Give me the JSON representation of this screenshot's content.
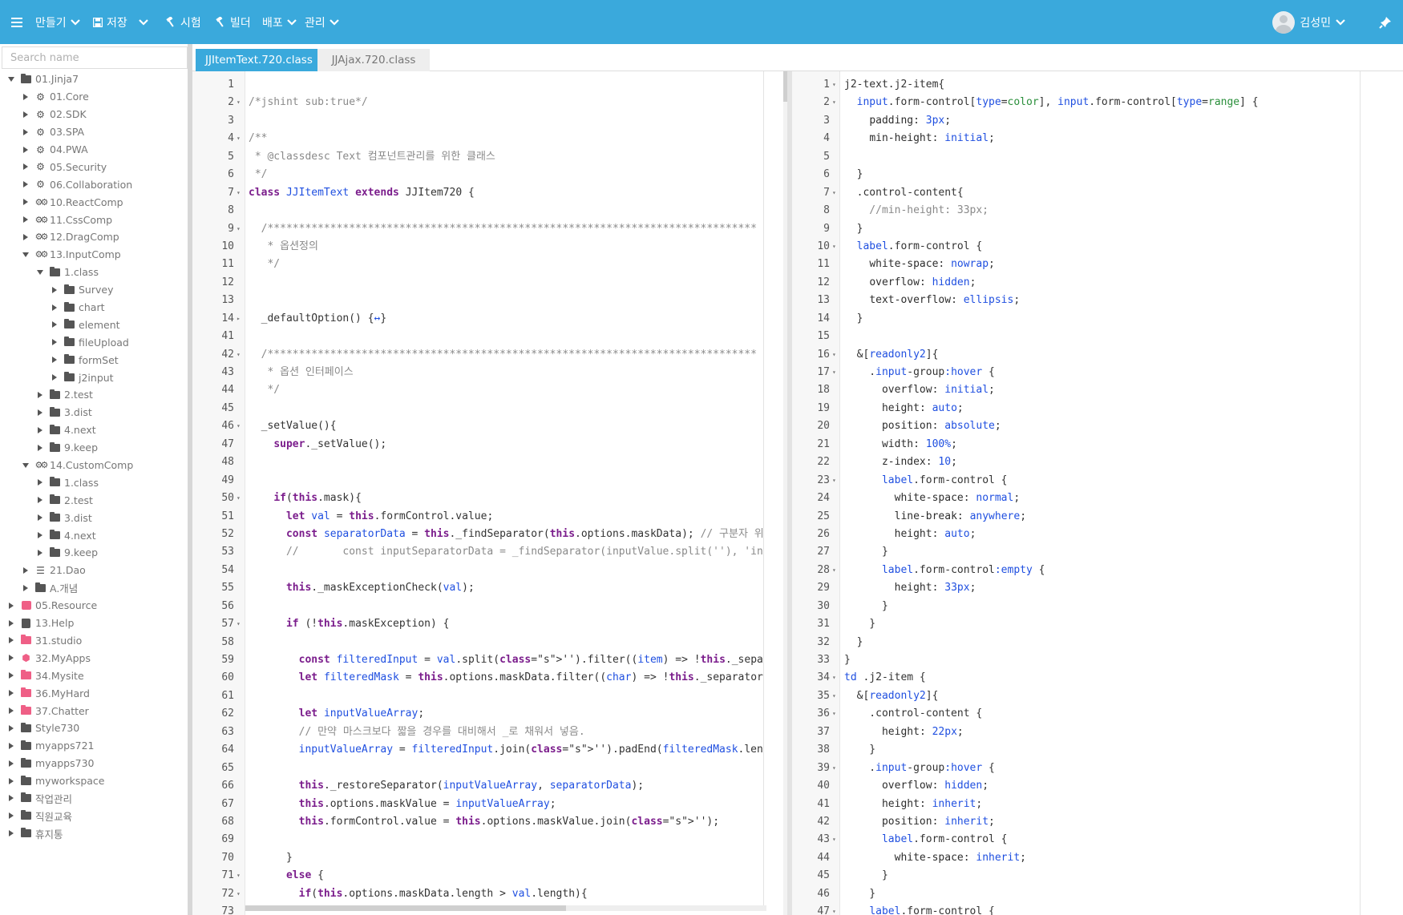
{
  "toolbar": {
    "menu_icon": "hamburger-icon",
    "make_label": "만들기",
    "save_label": "저장",
    "test_label": "시험",
    "build_label": "빌더",
    "deploy_label": "배포",
    "admin_label": "관리",
    "user_name": "김성민"
  },
  "search": {
    "placeholder": "Search name",
    "value": ""
  },
  "tree": [
    {
      "label": "01.Jinja7",
      "icon": "folder",
      "depth": 0,
      "expanded": true
    },
    {
      "label": "01.Core",
      "icon": "gear",
      "depth": 1
    },
    {
      "label": "02.SDK",
      "icon": "gear",
      "depth": 1
    },
    {
      "label": "03.SPA",
      "icon": "gear",
      "depth": 1
    },
    {
      "label": "04.PWA",
      "icon": "gear",
      "depth": 1
    },
    {
      "label": "05.Security",
      "icon": "gear",
      "depth": 1
    },
    {
      "label": "06.Collaboration",
      "icon": "gear",
      "depth": 1
    },
    {
      "label": "10.ReactComp",
      "icon": "gears",
      "depth": 1
    },
    {
      "label": "11.CssComp",
      "icon": "gears",
      "depth": 1
    },
    {
      "label": "12.DragComp",
      "icon": "gears",
      "depth": 1
    },
    {
      "label": "13.InputComp",
      "icon": "gears",
      "depth": 1,
      "expanded": true
    },
    {
      "label": "1.class",
      "icon": "folder",
      "depth": 2,
      "expanded": true
    },
    {
      "label": "Survey",
      "icon": "folder",
      "depth": 3
    },
    {
      "label": "chart",
      "icon": "folder",
      "depth": 3
    },
    {
      "label": "element",
      "icon": "folder",
      "depth": 3
    },
    {
      "label": "fileUpload",
      "icon": "folder",
      "depth": 3
    },
    {
      "label": "formSet",
      "icon": "folder",
      "depth": 3
    },
    {
      "label": "j2input",
      "icon": "folder",
      "depth": 3
    },
    {
      "label": "2.test",
      "icon": "folder",
      "depth": 2
    },
    {
      "label": "3.dist",
      "icon": "folder",
      "depth": 2
    },
    {
      "label": "4.next",
      "icon": "folder",
      "depth": 2
    },
    {
      "label": "9.keep",
      "icon": "folder",
      "depth": 2
    },
    {
      "label": "14.CustomComp",
      "icon": "gears",
      "depth": 1,
      "expanded": true
    },
    {
      "label": "1.class",
      "icon": "folder",
      "depth": 2
    },
    {
      "label": "2.test",
      "icon": "folder",
      "depth": 2
    },
    {
      "label": "3.dist",
      "icon": "folder",
      "depth": 2
    },
    {
      "label": "4.next",
      "icon": "folder",
      "depth": 2
    },
    {
      "label": "9.keep",
      "icon": "folder",
      "depth": 2
    },
    {
      "label": "21.Dao",
      "icon": "db",
      "depth": 1
    },
    {
      "label": "A.개념",
      "icon": "folder",
      "depth": 1
    },
    {
      "label": "05.Resource",
      "icon": "res",
      "depth": 0
    },
    {
      "label": "13.Help",
      "icon": "book",
      "depth": 0
    },
    {
      "label": "31.studio",
      "icon": "folder-pink",
      "depth": 0
    },
    {
      "label": "32.MyApps",
      "icon": "cube",
      "depth": 0
    },
    {
      "label": "34.Mysite",
      "icon": "folder-pink",
      "depth": 0
    },
    {
      "label": "36.MyHard",
      "icon": "folder-pink",
      "depth": 0
    },
    {
      "label": "37.Chatter",
      "icon": "folder-pink",
      "depth": 0
    },
    {
      "label": "Style730",
      "icon": "folder",
      "depth": 0
    },
    {
      "label": "myapps721",
      "icon": "folder",
      "depth": 0
    },
    {
      "label": "myapps730",
      "icon": "folder",
      "depth": 0
    },
    {
      "label": "myworkspace",
      "icon": "folder",
      "depth": 0
    },
    {
      "label": "작업관리",
      "icon": "folder",
      "depth": 0
    },
    {
      "label": "직원교육",
      "icon": "folder",
      "depth": 0
    },
    {
      "label": "휴지통",
      "icon": "folder",
      "depth": 0
    }
  ],
  "tabs": [
    {
      "label": "JJItemText.720.class",
      "active": true
    },
    {
      "label": "JJAjax.720.class",
      "active": false
    }
  ],
  "js_lines": [
    {
      "n": "1",
      "f": "",
      "code": ""
    },
    {
      "n": "2",
      "f": "▾",
      "code": "/*jshint sub:true*/"
    },
    {
      "n": "3",
      "f": "",
      "code": ""
    },
    {
      "n": "4",
      "f": "▾",
      "code": "/**"
    },
    {
      "n": "5",
      "f": "",
      "code": " * @classdesc Text 컴포넌트관리를 위한 클래스"
    },
    {
      "n": "6",
      "f": "",
      "code": " */"
    },
    {
      "n": "7",
      "f": "▾",
      "code": "class JJItemText extends JJItem720 {"
    },
    {
      "n": "8",
      "f": "",
      "code": ""
    },
    {
      "n": "9",
      "f": "▾",
      "code": "  /******************************************************************************"
    },
    {
      "n": "10",
      "f": "",
      "code": "   * 옵션정의"
    },
    {
      "n": "11",
      "f": "",
      "code": "   */"
    },
    {
      "n": "12",
      "f": "",
      "code": ""
    },
    {
      "n": "13",
      "f": "",
      "code": ""
    },
    {
      "n": "14",
      "f": "▸",
      "code": "  _defaultOption() {↔}"
    },
    {
      "n": "41",
      "f": "",
      "code": ""
    },
    {
      "n": "42",
      "f": "▾",
      "code": "  /******************************************************************************"
    },
    {
      "n": "43",
      "f": "",
      "code": "   * 옵션 인터페이스"
    },
    {
      "n": "44",
      "f": "",
      "code": "   */"
    },
    {
      "n": "45",
      "f": "",
      "code": ""
    },
    {
      "n": "46",
      "f": "▾",
      "code": "  _setValue(){"
    },
    {
      "n": "47",
      "f": "",
      "code": "    super._setValue();"
    },
    {
      "n": "48",
      "f": "",
      "code": ""
    },
    {
      "n": "49",
      "f": "",
      "code": ""
    },
    {
      "n": "50",
      "f": "▾",
      "code": "    if(this.mask){"
    },
    {
      "n": "51",
      "f": "",
      "code": "      let val = this.formControl.value;"
    },
    {
      "n": "52",
      "f": "",
      "code": "      const separatorData = this._findSeparator(this.options.maskData); // 구분자 위치 파"
    },
    {
      "n": "53",
      "f": "",
      "code": "      //       const inputSeparatorData = _findSeparator(inputValue.split(''), 'inputValu"
    },
    {
      "n": "54",
      "f": "",
      "code": ""
    },
    {
      "n": "55",
      "f": "",
      "code": "      this._maskExceptionCheck(val);"
    },
    {
      "n": "56",
      "f": "",
      "code": ""
    },
    {
      "n": "57",
      "f": "▾",
      "code": "      if (!this.maskException) {"
    },
    {
      "n": "58",
      "f": "",
      "code": ""
    },
    {
      "n": "59",
      "f": "",
      "code": "        const filteredInput = val.split('').filter((item) => !this._separatorCheck(item))"
    },
    {
      "n": "60",
      "f": "",
      "code": "        let filteredMask = this.options.maskData.filter((char) => !this._separatorCheck(c"
    },
    {
      "n": "61",
      "f": "",
      "code": ""
    },
    {
      "n": "62",
      "f": "",
      "code": "        let inputValueArray;"
    },
    {
      "n": "63",
      "f": "",
      "code": "        // 만약 마스크보다 짧을 경우를 대비해서 _로 채워서 넣음."
    },
    {
      "n": "64",
      "f": "",
      "code": "        inputValueArray = filteredInput.join('').padEnd(filteredMask.length, '_').split('"
    },
    {
      "n": "65",
      "f": "",
      "code": ""
    },
    {
      "n": "66",
      "f": "",
      "code": "        this._restoreSeparator(inputValueArray, separatorData);"
    },
    {
      "n": "67",
      "f": "",
      "code": "        this.options.maskValue = inputValueArray;"
    },
    {
      "n": "68",
      "f": "",
      "code": "        this.formControl.value = this.options.maskValue.join('');"
    },
    {
      "n": "69",
      "f": "",
      "code": ""
    },
    {
      "n": "70",
      "f": "",
      "code": "      }"
    },
    {
      "n": "71",
      "f": "▾",
      "code": "      else {"
    },
    {
      "n": "72",
      "f": "▾",
      "code": "        if(this.options.maskData.length > val.length){"
    },
    {
      "n": "73",
      "f": "",
      "code": ""
    }
  ],
  "css_lines": [
    {
      "n": "1",
      "f": "▾",
      "code": "j2-text.j2-item{"
    },
    {
      "n": "2",
      "f": "▾",
      "code": "  input.form-control[type=color], input.form-control[type=range] {"
    },
    {
      "n": "3",
      "f": "",
      "code": "    padding: 3px;"
    },
    {
      "n": "4",
      "f": "",
      "code": "    min-height: initial;"
    },
    {
      "n": "5",
      "f": "",
      "code": ""
    },
    {
      "n": "6",
      "f": "",
      "code": "  }"
    },
    {
      "n": "7",
      "f": "▾",
      "code": "  .control-content{"
    },
    {
      "n": "8",
      "f": "",
      "code": "    //min-height: 33px;"
    },
    {
      "n": "9",
      "f": "",
      "code": "  }"
    },
    {
      "n": "10",
      "f": "▾",
      "code": "  label.form-control {"
    },
    {
      "n": "11",
      "f": "",
      "code": "    white-space: nowrap;"
    },
    {
      "n": "12",
      "f": "",
      "code": "    overflow: hidden;"
    },
    {
      "n": "13",
      "f": "",
      "code": "    text-overflow: ellipsis;"
    },
    {
      "n": "14",
      "f": "",
      "code": "  }"
    },
    {
      "n": "15",
      "f": "",
      "code": ""
    },
    {
      "n": "16",
      "f": "▾",
      "code": "  &[readonly2]{"
    },
    {
      "n": "17",
      "f": "▾",
      "code": "    .input-group:hover {"
    },
    {
      "n": "18",
      "f": "",
      "code": "      overflow: initial;"
    },
    {
      "n": "19",
      "f": "",
      "code": "      height: auto;"
    },
    {
      "n": "20",
      "f": "",
      "code": "      position: absolute;"
    },
    {
      "n": "21",
      "f": "",
      "code": "      width: 100%;"
    },
    {
      "n": "22",
      "f": "",
      "code": "      z-index: 10;"
    },
    {
      "n": "23",
      "f": "▾",
      "code": "      label.form-control {"
    },
    {
      "n": "24",
      "f": "",
      "code": "        white-space: normal;"
    },
    {
      "n": "25",
      "f": "",
      "code": "        line-break: anywhere;"
    },
    {
      "n": "26",
      "f": "",
      "code": "        height: auto;"
    },
    {
      "n": "27",
      "f": "",
      "code": "      }"
    },
    {
      "n": "28",
      "f": "▾",
      "code": "      label.form-control:empty {"
    },
    {
      "n": "29",
      "f": "",
      "code": "        height: 33px;"
    },
    {
      "n": "30",
      "f": "",
      "code": "      }"
    },
    {
      "n": "31",
      "f": "",
      "code": "    }"
    },
    {
      "n": "32",
      "f": "",
      "code": "  }"
    },
    {
      "n": "33",
      "f": "",
      "code": "}"
    },
    {
      "n": "34",
      "f": "▾",
      "code": "td .j2-item {"
    },
    {
      "n": "35",
      "f": "▾",
      "code": "  &[readonly2]{"
    },
    {
      "n": "36",
      "f": "▾",
      "code": "    .control-content {"
    },
    {
      "n": "37",
      "f": "",
      "code": "      height: 22px;"
    },
    {
      "n": "38",
      "f": "",
      "code": "    }"
    },
    {
      "n": "39",
      "f": "▾",
      "code": "    .input-group:hover {"
    },
    {
      "n": "40",
      "f": "",
      "code": "      overflow: hidden;"
    },
    {
      "n": "41",
      "f": "",
      "code": "      height: inherit;"
    },
    {
      "n": "42",
      "f": "",
      "code": "      position: inherit;"
    },
    {
      "n": "43",
      "f": "▾",
      "code": "      label.form-control {"
    },
    {
      "n": "44",
      "f": "",
      "code": "        white-space: inherit;"
    },
    {
      "n": "45",
      "f": "",
      "code": "      }"
    },
    {
      "n": "46",
      "f": "",
      "code": "    }"
    },
    {
      "n": "47",
      "f": "▾",
      "code": "    label.form-control {"
    }
  ]
}
